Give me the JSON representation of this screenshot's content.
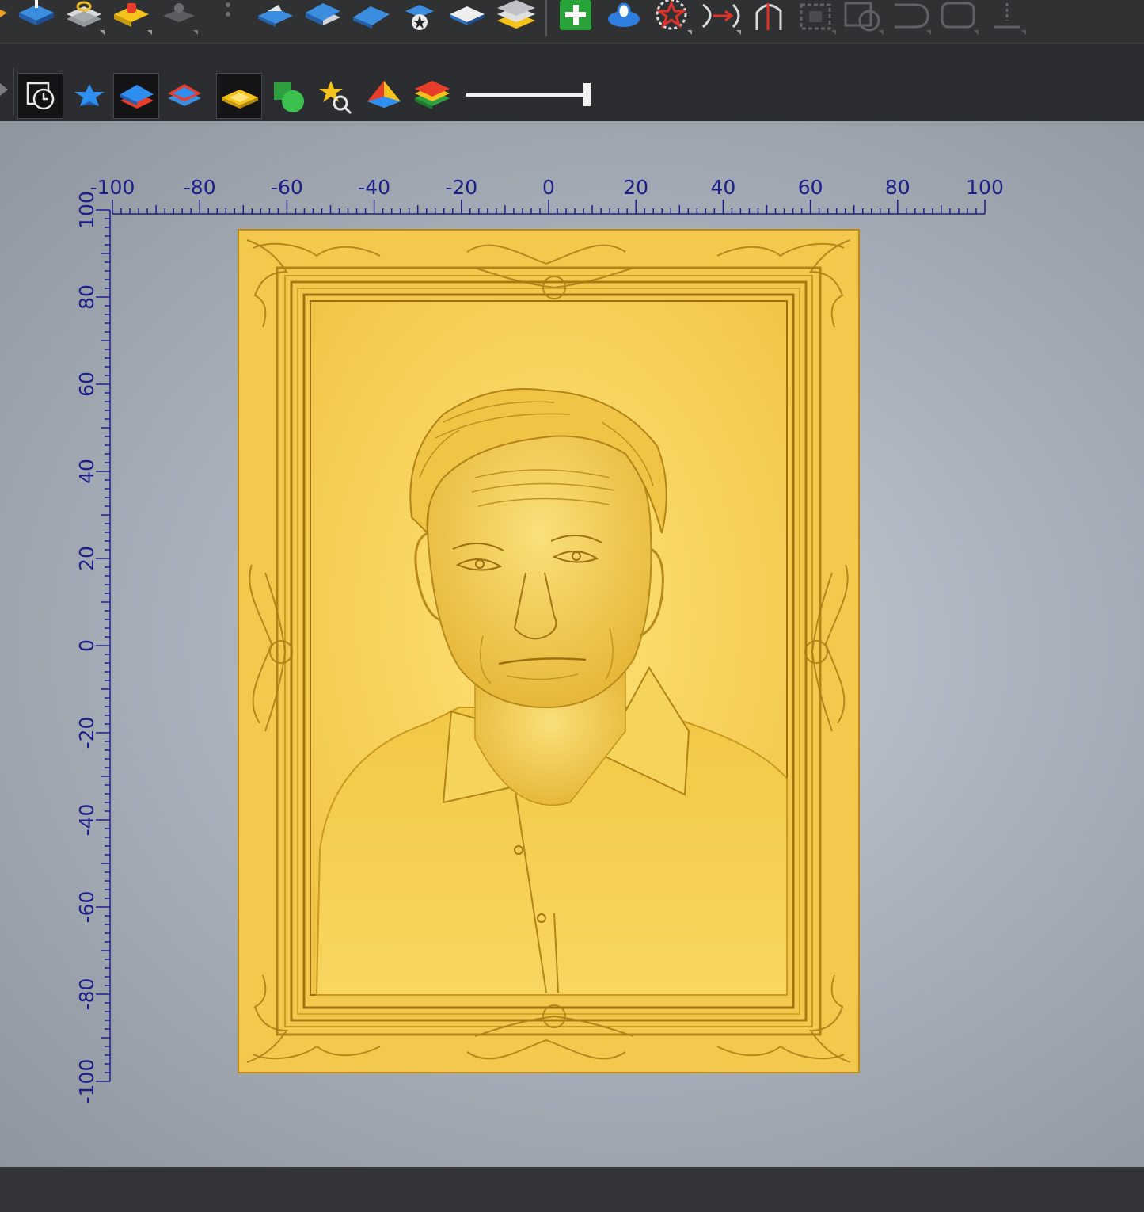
{
  "toolbar_top": {
    "icons": [
      "layer-up-icon",
      "layer-stack-icon",
      "bump-icon",
      "chess-pawn-icon",
      "dot-icon",
      "layer-move-icon",
      "layer-extrude-icon",
      "layer-bend-icon",
      "star-badge-icon",
      "layer-flat-icon",
      "layer-stack-up-icon",
      "add-icon",
      "dome-icon",
      "star-outline-icon",
      "path-arrow-icon",
      "half-arch-icon",
      "select-box-icon",
      "select-circle-icon",
      "curve-icon",
      "rect-icon",
      "align-icon"
    ]
  },
  "toolbar_second": {
    "icons": [
      "clock-square-icon",
      "star-flat-icon",
      "layers-blue-red-icon",
      "layers-red-icon",
      "layer-yellow-icon",
      "shapes-green-icon",
      "star-search-icon",
      "pyramid-icon",
      "layers-multicolor-icon"
    ],
    "slider_value": 1.0
  },
  "viewport": {
    "ruler_x_labels": [
      "-100",
      "-80",
      "-60",
      "-40",
      "-20",
      "0",
      "20",
      "40",
      "60",
      "80",
      "100"
    ],
    "ruler_y_labels": [
      "100",
      "80",
      "60",
      "40",
      "20",
      "0",
      "-20",
      "-40",
      "-60",
      "-80",
      "-100"
    ],
    "ruler_color": "#1b1f8a",
    "relief_color": "#f5cf4e"
  }
}
